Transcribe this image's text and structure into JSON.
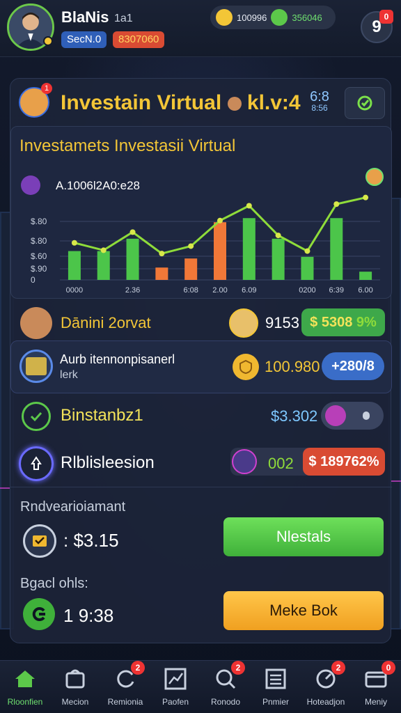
{
  "header": {
    "username": "BlaNis",
    "user_sub": "1a1",
    "badge_blue": "SecN.0",
    "badge_red": "8307060",
    "currency_1": "100996",
    "currency_2": "356046",
    "settings_label": "9",
    "settings_badge": "0"
  },
  "panel": {
    "title": "Investain Virtual",
    "title_suffix": "kl.v:4",
    "time_top": "6:8",
    "time_bottom": "8:56",
    "avatar_badge": "1"
  },
  "chart": {
    "title": "Investamets Investasii Virtual",
    "label": "A.1006l2A0:e28",
    "y_ticks": [
      "$.80",
      "$.80",
      "$.60",
      "$.90",
      "0"
    ]
  },
  "chart_data": {
    "type": "bar",
    "title": "Investamets Investasii Virtual",
    "categories": [
      "0000",
      "",
      "2.36",
      "",
      "6:08",
      "2.00",
      "6.09",
      "",
      "0200",
      "6:39",
      "6.00"
    ],
    "series": [
      {
        "values": [
          3.5,
          3.5,
          5,
          1.5,
          2.6,
          7,
          7.5,
          5,
          2.8,
          7.5,
          1
        ]
      },
      {
        "values": [
          4.5,
          3.6,
          5.8,
          3.2,
          4.1,
          7.2,
          9,
          5.4,
          3.5,
          9.2,
          10
        ]
      }
    ],
    "bar_colors": [
      "#4cc54a",
      "#4cc54a",
      "#4cc54a",
      "#f07838",
      "#f07838",
      "#f07838",
      "#4cc54a",
      "#4cc54a",
      "#4cc54a",
      "#4cc54a",
      "#4cc54a"
    ],
    "line_color": "#8fdc3a",
    "ylim": [
      0,
      12
    ]
  },
  "rows": {
    "r1": {
      "label": "Dānini 2orvat",
      "value": "9153",
      "pill": "$ 5308",
      "pill_suffix": "9%"
    },
    "r2": {
      "label_1": "Aurb itennonpisanerl",
      "label_2": "lerk",
      "value": "100.980",
      "pill": "+280/8"
    },
    "r3": {
      "label": "Binstanbz1",
      "value": "$3.302"
    },
    "r4": {
      "label": "Rlblisleesion",
      "value": "002",
      "pill": "$ 189762%"
    }
  },
  "bottom": {
    "section_1": "Rndvearioiamant",
    "value_1": "$3.15",
    "prefix_1": ":",
    "button_1": "Nlestals",
    "section_2": "Bgacl ohls:",
    "value_2": "9:38",
    "prefix_2": "1",
    "button_2": "Meke Bok"
  },
  "nav": {
    "items": [
      {
        "label": "Rloonfien",
        "badge": ""
      },
      {
        "label": "Mecion",
        "badge": ""
      },
      {
        "label": "Remionia",
        "badge": "2"
      },
      {
        "label": "Paofen",
        "badge": ""
      },
      {
        "label": "Ronodo",
        "badge": "2"
      },
      {
        "label": "Pnmier",
        "badge": ""
      },
      {
        "label": "Hoteadjon",
        "badge": "2"
      },
      {
        "label": "Meniy",
        "badge": "0"
      }
    ]
  }
}
